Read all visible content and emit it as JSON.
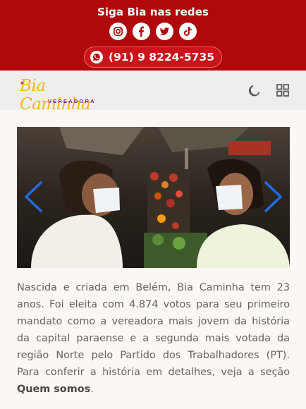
{
  "header": {
    "follow_title": "Siga Bia nas redes",
    "socials": [
      "instagram-icon",
      "facebook-icon",
      "twitter-icon",
      "tiktok-icon"
    ],
    "phone": "(91) 9 8224-5735",
    "colors": {
      "bar": "#b1080c",
      "pill_border": "#f06a6a"
    }
  },
  "nav": {
    "logo_name": "Bia Caminha",
    "logo_subtitle": "VEREADORA",
    "theme_toggle_icon": "moon-icon",
    "menu_icon": "grid-icon"
  },
  "slider": {
    "prev_icon": "chevron-left-icon",
    "next_icon": "chevron-right-icon",
    "arrow_color": "#1e6ee8"
  },
  "bio": {
    "text": "Nascida e criada em Belém, Bia Caminha tem 23 anos. Foi eleita com 4.874 votos para seu primeiro mandato como a vereadora mais jovem da história da capital paraense e a segunda mais votada da região Norte pelo Partido dos Trabalhadores (PT). Para conferir a história em detalhes, veja a seção ",
    "link_text": "Quem somos",
    "tail": "."
  }
}
